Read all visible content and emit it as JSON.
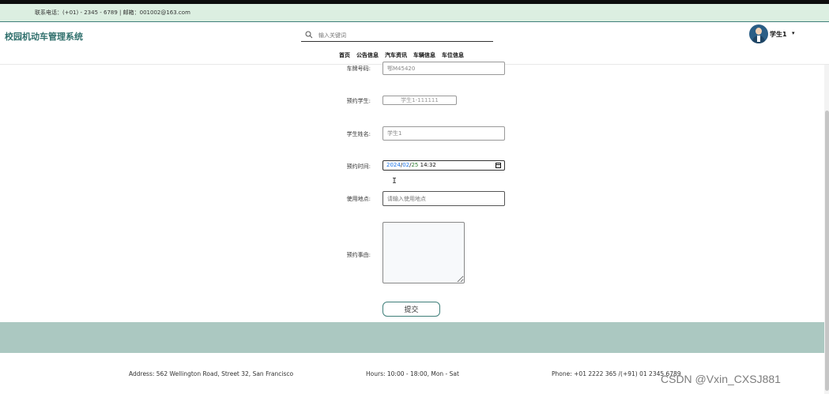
{
  "contact": {
    "text": "联系电话：(+01) - 2345 - 6789 | 邮箱：001002@163.com"
  },
  "header": {
    "title": "校园机动车管理系统",
    "search_placeholder": "输入关键词",
    "user_name": "学生1",
    "caret": "▾"
  },
  "nav": [
    "首页",
    "公告信息",
    "汽车资讯",
    "车辆信息",
    "车位信息"
  ],
  "form": {
    "plate": {
      "label": "车牌号码:",
      "value": "鄂M45420"
    },
    "student_account": {
      "label": "预约学生:",
      "value": "学生1-111111"
    },
    "student_name": {
      "label": "学生姓名:",
      "value": "学生1"
    },
    "reserve_time": {
      "label": "预约时间:",
      "year": "2024",
      "month": "02",
      "day": "25",
      "time": "14:32"
    },
    "location": {
      "label": "使用地点:",
      "placeholder": "请输入使用地点"
    },
    "reason": {
      "label": "预约事由:",
      "value": ""
    },
    "submit": "提交"
  },
  "footer": {
    "address": "Address: 562 Wellington Road, Street 32, San Francisco",
    "hours": "Hours: 10:00 - 18:00, Mon - Sat",
    "phone": "Phone: +01 2222 365 /(+91) 01 2345 6789"
  },
  "watermark": "CSDN @Vxin_CXSJ881"
}
